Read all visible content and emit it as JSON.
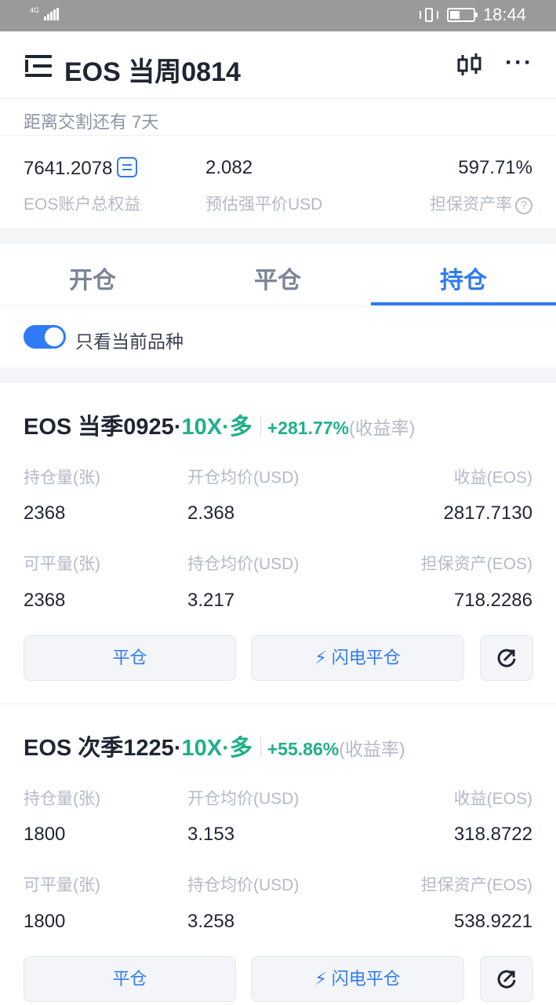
{
  "status_bar": {
    "network": "4G",
    "time": "18:44"
  },
  "header": {
    "title": "EOS 当周0814"
  },
  "delivery_notice": "距离交割还有 7天",
  "summary": [
    {
      "value": "7641.2078",
      "label": "EOS账户总权益"
    },
    {
      "value": "2.082",
      "label": "预估强平价USD"
    },
    {
      "value": "597.71%",
      "label": "担保资产率"
    }
  ],
  "tabs": [
    {
      "label": "开仓",
      "active": false
    },
    {
      "label": "平仓",
      "active": false
    },
    {
      "label": "持仓",
      "active": true
    }
  ],
  "filter": {
    "label": "只看当前品种",
    "enabled": true
  },
  "positions": [
    {
      "name": "EOS 当季0925·",
      "leverage": "10X·多",
      "return_pct": "+281.77%",
      "return_label": "(收益率)",
      "fields": {
        "holding_qty_label": "持仓量(张)",
        "holding_qty": "2368",
        "open_avg_label": "开仓均价(USD)",
        "open_avg": "2.368",
        "pnl_label": "收益(EOS)",
        "pnl": "2817.7130",
        "closable_label": "可平量(张)",
        "closable": "2368",
        "hold_avg_label": "持仓均价(USD)",
        "hold_avg": "3.217",
        "margin_label": "担保资产(EOS)",
        "margin": "718.2286"
      },
      "buttons": {
        "close": "平仓",
        "flash_close": "闪电平仓"
      }
    },
    {
      "name": "EOS 次季1225·",
      "leverage": "10X·多",
      "return_pct": "+55.86%",
      "return_label": "(收益率)",
      "fields": {
        "holding_qty_label": "持仓量(张)",
        "holding_qty": "1800",
        "open_avg_label": "开仓均价(USD)",
        "open_avg": "3.153",
        "pnl_label": "收益(EOS)",
        "pnl": "318.8722",
        "closable_label": "可平量(张)",
        "closable": "1800",
        "hold_avg_label": "持仓均价(USD)",
        "hold_avg": "3.258",
        "margin_label": "担保资产(EOS)",
        "margin": "538.9221"
      },
      "buttons": {
        "close": "平仓",
        "flash_close": "闪电平仓"
      }
    }
  ],
  "colors": {
    "accent": "#2f7bf5",
    "profit": "#1fb08a",
    "muted": "#b4bac6"
  }
}
